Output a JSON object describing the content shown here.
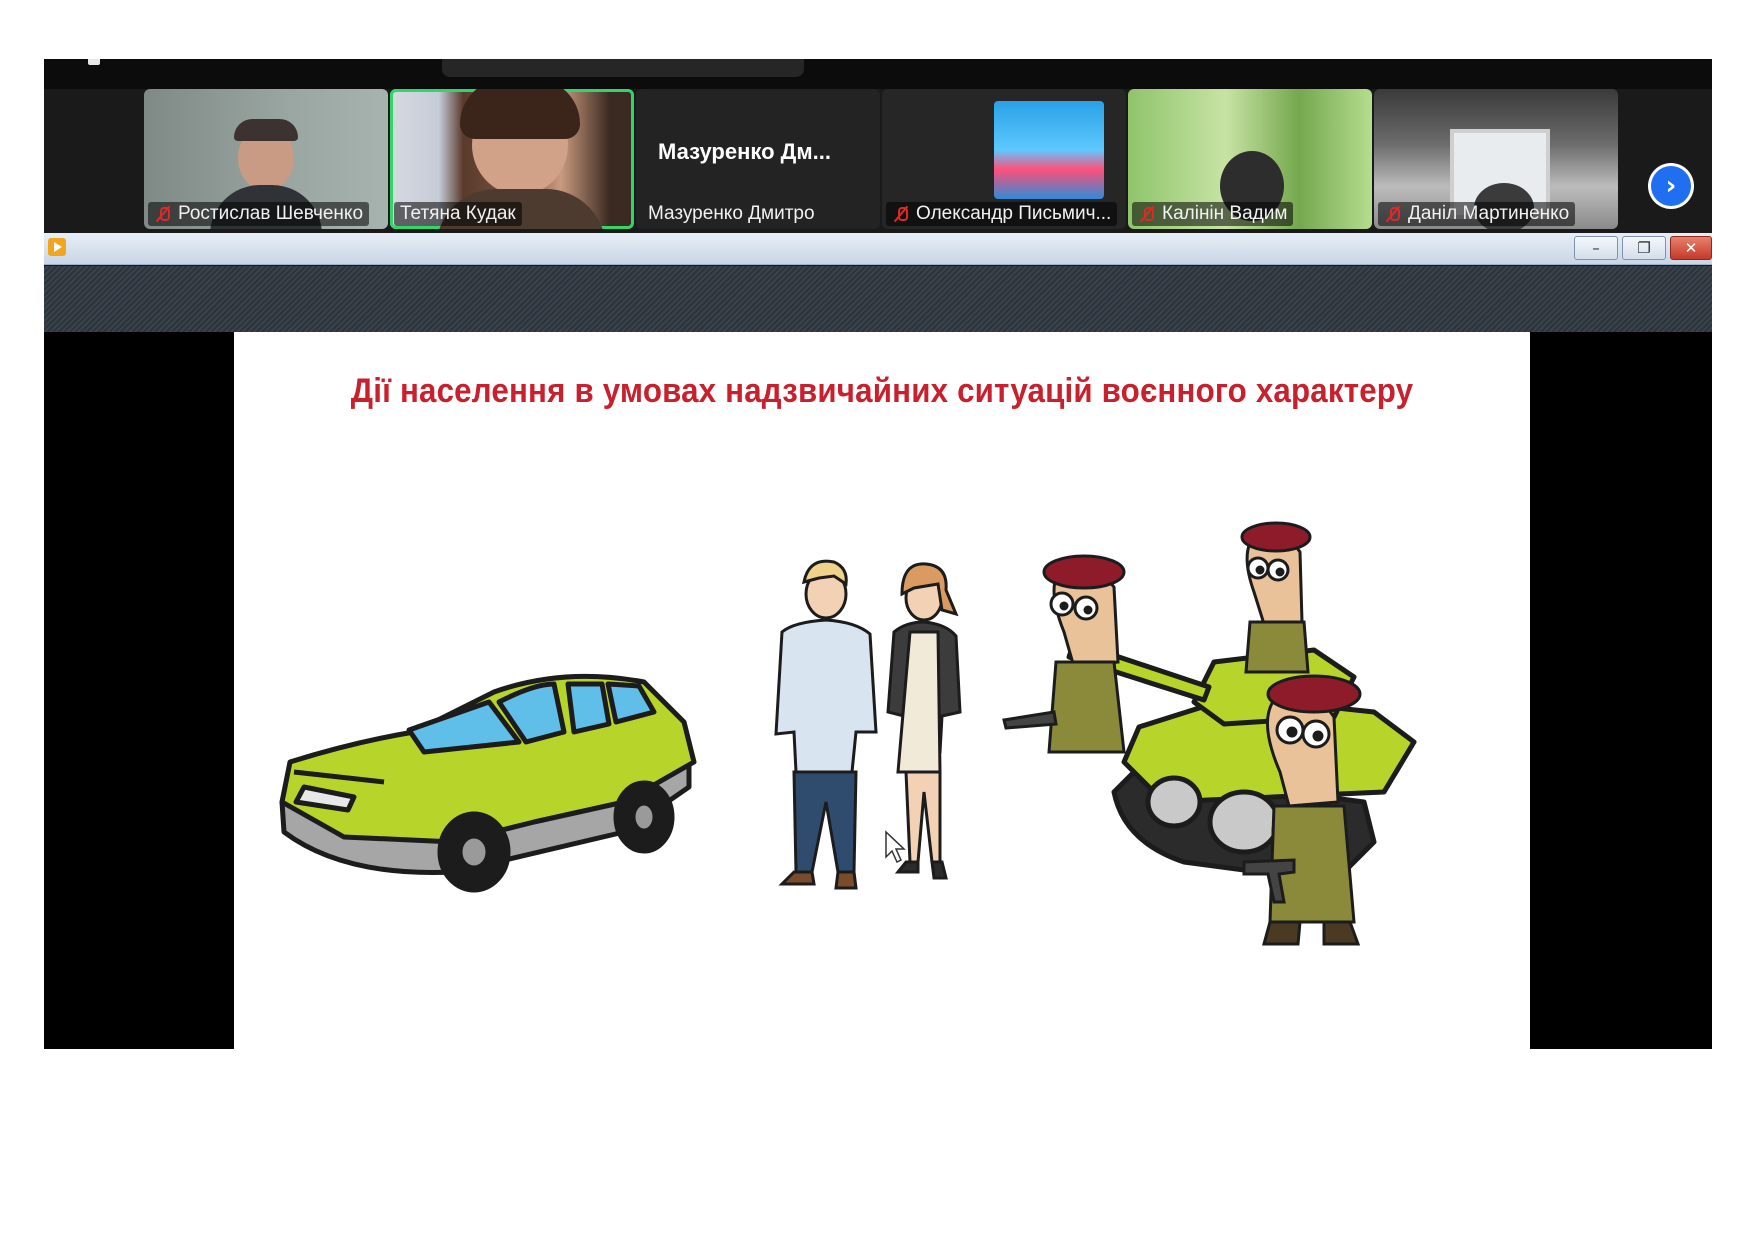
{
  "meeting": {
    "participants": [
      {
        "name": "Ростислав Шевченко",
        "muted": true
      },
      {
        "name": "Тетяна Кудак",
        "muted": false,
        "active": true
      },
      {
        "name": "Мазуренко Дмитро",
        "muted": false,
        "display_name": "Мазуренко Дм..."
      },
      {
        "name": "Олександр Письмич...",
        "muted": true
      },
      {
        "name": "Калінін Вадим",
        "muted": true
      },
      {
        "name": "Даніл Мартиненко",
        "muted": true
      }
    ],
    "next_page_icon": "chevron-right-icon"
  },
  "window": {
    "minimize_glyph": "–",
    "restore_glyph": "❐",
    "close_glyph": "✕"
  },
  "slide": {
    "title": "Дії населення в умовах надзвичайних ситуацій воєнного характеру",
    "illustrations": [
      "car",
      "man",
      "woman",
      "tank",
      "soldiers"
    ]
  },
  "colors": {
    "title_red": "#c8202c",
    "active_speaker": "#2fd66a",
    "vehicle_green": "#b7d42a",
    "beret": "#8e1b2a"
  }
}
